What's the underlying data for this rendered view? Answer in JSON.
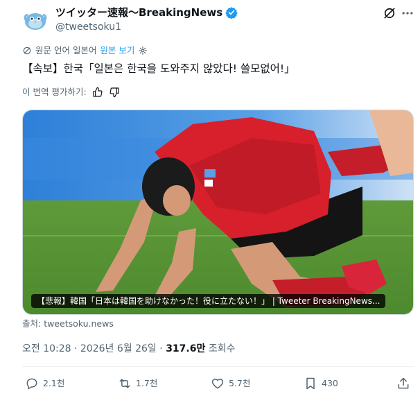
{
  "author": {
    "display_name": "ツイッター速報〜BreakingNews",
    "handle": "@tweetsoku1"
  },
  "translation_bar": {
    "source_language": "원문 언어 일본어",
    "show_original": "원본 보기"
  },
  "tweet": {
    "text": "【속보】한국「일본은 한국을 도와주지 않았다! 쓸모없어!」"
  },
  "rate_translation": {
    "label": "이 번역 평가하기:"
  },
  "media": {
    "caption": "【悲報】韓国「日本は韓国を助けなかった！役に立たない！」 | Tweeter BreakingNews..."
  },
  "source": {
    "prefix": "출처: ",
    "link": "tweetsoku.news"
  },
  "meta": {
    "time": "오전 10:28",
    "date": "2026년 6월 26일",
    "views_count": "317.6만",
    "views_label": "조회수"
  },
  "actions": {
    "replies": "2.1천",
    "reposts": "1.7천",
    "likes": "5.7천",
    "bookmarks": "430"
  },
  "colors": {
    "accent": "#1d9bf0",
    "secondary_text": "#536471",
    "primary_text": "#0f1419"
  }
}
